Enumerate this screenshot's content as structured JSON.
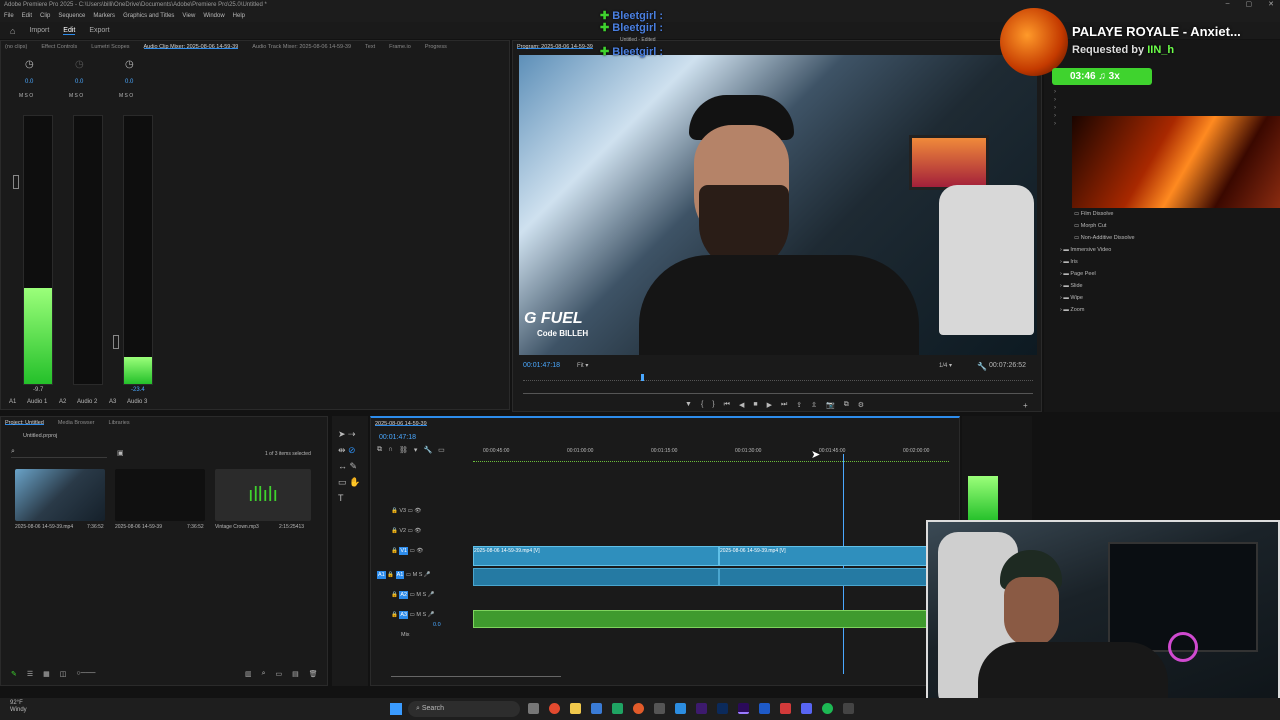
{
  "titlebar": "Adobe Premiere Pro 2025 - C:\\Users\\billi\\OneDrive\\Documents\\Adobe\\Premiere Pro\\25.0\\Untitled *",
  "menu": [
    "File",
    "Edit",
    "Clip",
    "Sequence",
    "Markers",
    "Graphics and Titles",
    "View",
    "Window",
    "Help"
  ],
  "workspace": {
    "import": "Import",
    "edit": "Edit",
    "export": "Export"
  },
  "top_tabs": {
    "no_clips": "(no clips)",
    "effect_controls": "Effect Controls",
    "lumetri": "Lumetri Scopes",
    "audio_clip_mixer": "Audio Clip Mixer: 2025-08-06 14-59-39",
    "audio_track_mixer": "Audio Track Mixer: 2025-08-06 14-59-39",
    "text": "Text",
    "frameio": "Frame.io",
    "progress": "Progress"
  },
  "mixer": {
    "channels": [
      {
        "val": "0.0",
        "peak": "-9.7",
        "name": "A1",
        "label": "Audio 1",
        "level": 0.36
      },
      {
        "val": "0.0",
        "peak": "",
        "name": "A2",
        "label": "Audio 2",
        "level": 0
      },
      {
        "val": "0.0",
        "peak": "-23.4",
        "name": "A3",
        "label": "Audio 3",
        "level": 0.1
      }
    ],
    "msr": "M  S  O"
  },
  "program": {
    "tab": "Program: 2025-08-06 14-59-39",
    "timecode": "00:01:47:18",
    "fit": "Fit",
    "quality": "1/4",
    "duration": "00:07:26:52",
    "overlay_brand": "G FUEL",
    "overlay_code": "Code BILLEH"
  },
  "stream_overlay": {
    "chat": [
      "Bleetgirl :",
      "Bleetgirl :",
      "Bleetgirl :"
    ],
    "edited": "Untitled - Edited",
    "song": "PALAYE ROYALE - Anxiet...",
    "requested": "Requested by",
    "requester": "IIN_h",
    "time": "03:46",
    "count": "3x"
  },
  "effects": {
    "items": [
      "Film Dissolve",
      "Morph Cut",
      "Non-Additive Dissolve"
    ],
    "folders": [
      "Immersive Video",
      "Iris",
      "Page Peel",
      "Slide",
      "Wipe",
      "Zoom"
    ]
  },
  "project": {
    "tabs": [
      "Project: Untitled",
      "Media Browser",
      "Libraries"
    ],
    "file": "Untitled.prproj",
    "selected": "1 of 3 items selected",
    "items": [
      {
        "name": "2025-08-06 14-59-39.mp4",
        "dur": "7:36:52"
      },
      {
        "name": "2025-08-06 14-59-39",
        "dur": "7:36:52"
      },
      {
        "name": "Vintage Crown.mp3",
        "dur": "2:15:25413"
      }
    ]
  },
  "timeline": {
    "tab": "2025-08-06 14-59-39",
    "timecode": "00:01:47:18",
    "ruler": [
      "00:00:45:00",
      "00:01:00:00",
      "00:01:15:00",
      "00:01:30:00",
      "00:01:45:00",
      "00:02:00:00"
    ],
    "tracks": [
      "V3",
      "V2",
      "V1",
      "A1",
      "A2",
      "A3",
      "Mix"
    ],
    "mix_val": "0.0",
    "clip1": "2025-08-06 14-59-39.mp4 [V]",
    "clip2": "2025-08-06 14-59-39.mp4 [V]"
  },
  "taskbar": {
    "temp": "92°F",
    "weather": "Windy",
    "search": "Search"
  },
  "colors": {
    "accent": "#2d8ceb",
    "green": "#3fd32e"
  }
}
